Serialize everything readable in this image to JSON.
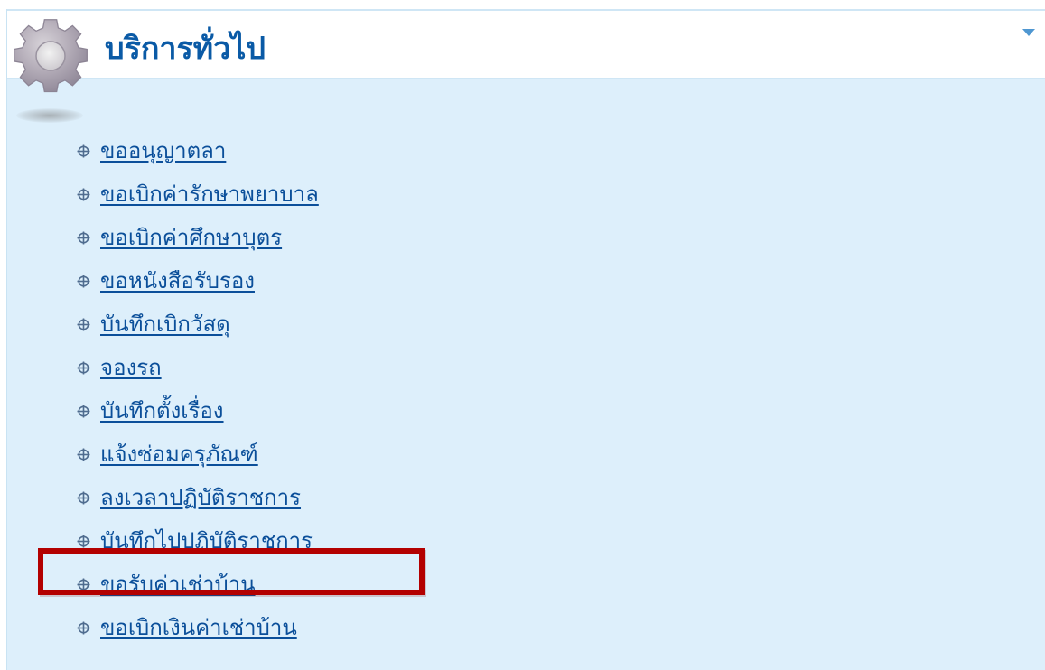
{
  "panel": {
    "title": "บริการทั่วไป",
    "header_icon": "gear-icon",
    "collapse_icon": "collapse-arrow-icon"
  },
  "menu": {
    "items": [
      {
        "label": "ขออนุญาตลา",
        "icon": "bullet-cross-icon"
      },
      {
        "label": "ขอเบิกค่ารักษาพยาบาล",
        "icon": "bullet-cross-icon"
      },
      {
        "label": "ขอเบิกค่าศึกษาบุตร",
        "icon": "bullet-cross-icon"
      },
      {
        "label": "ขอหนังสือรับรอง",
        "icon": "bullet-cross-icon"
      },
      {
        "label": "บันทึกเบิกวัสดุ",
        "icon": "bullet-cross-icon"
      },
      {
        "label": "จองรถ",
        "icon": "bullet-cross-icon"
      },
      {
        "label": "บันทึกตั้งเรื่อง",
        "icon": "bullet-cross-icon"
      },
      {
        "label": "แจ้งซ่อมครุภัณฑ์",
        "icon": "bullet-cross-icon"
      },
      {
        "label": "ลงเวลาปฏิบัติราชการ",
        "icon": "bullet-cross-icon"
      },
      {
        "label": "บันทึกไปปฏิบัติราชการ",
        "icon": "bullet-cross-icon"
      },
      {
        "label": "ขอรับค่าเช่าบ้าน",
        "icon": "bullet-cross-icon"
      },
      {
        "label": "ขอเบิกเงินค่าเช่าบ้าน",
        "icon": "bullet-cross-icon"
      }
    ]
  },
  "highlight": {
    "target_item_index": 10,
    "color": "#b30000"
  },
  "colors": {
    "panel_background": "#ddeffb",
    "link": "#0b4f9a",
    "title": "#0a5aa6",
    "header_background": "#ffffff"
  }
}
